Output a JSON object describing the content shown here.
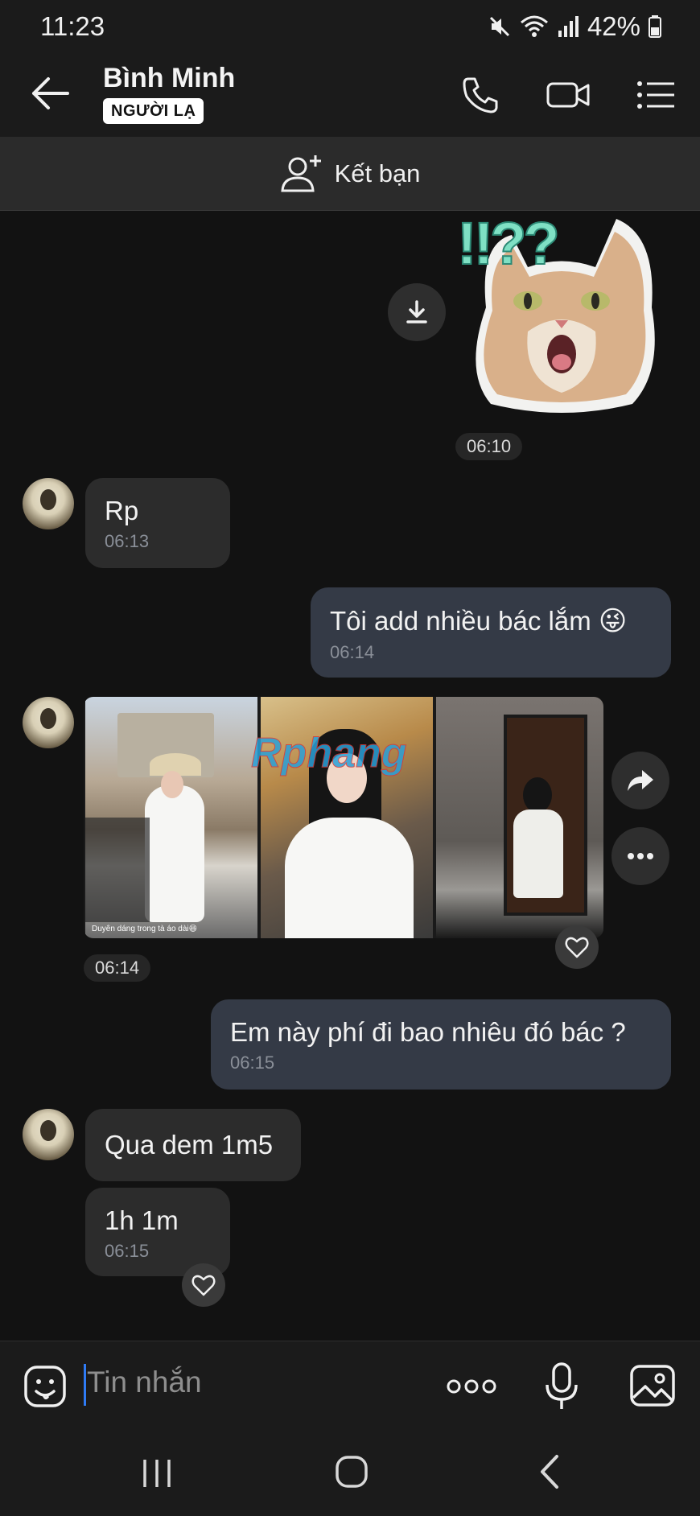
{
  "status_bar": {
    "time": "11:23",
    "battery": "42%"
  },
  "header": {
    "contact_name": "Bình Minh",
    "badge": "NGƯỜI LẠ"
  },
  "add_friend": {
    "label": "Kết bạn"
  },
  "messages": [
    {
      "id": "sticker",
      "direction": "out",
      "type": "sticker",
      "sticker_text": "!!??",
      "time": "06:10"
    },
    {
      "id": "m1",
      "direction": "in",
      "text": "Rp",
      "time": "06:13"
    },
    {
      "id": "m2",
      "direction": "out",
      "text": "Tôi add nhiều bác lắm",
      "emoji": "😜",
      "time": "06:14"
    },
    {
      "id": "m3",
      "direction": "in",
      "type": "photos",
      "count": 3,
      "caption": "Duyên dáng trong tà áo dài😆",
      "watermark": "Rphang",
      "time": "06:14"
    },
    {
      "id": "m4",
      "direction": "out",
      "text": "Em này phí đi bao nhiêu đó bác ?",
      "time": "06:15"
    },
    {
      "id": "m5",
      "direction": "in",
      "text": "Qua dem 1m5"
    },
    {
      "id": "m6",
      "direction": "in",
      "text": "1h 1m",
      "time": "06:15"
    }
  ],
  "composer": {
    "placeholder": "Tin nhắn"
  },
  "icons": [
    "mute-icon",
    "wifi-icon",
    "signal-icon",
    "battery-icon",
    "back-arrow-icon",
    "phone-icon",
    "video-icon",
    "menu-icon",
    "add-friend-icon",
    "download-icon",
    "share-icon",
    "more-icon",
    "heart-icon",
    "sticker-icon",
    "more-dots-icon",
    "mic-icon",
    "image-icon",
    "recents-icon",
    "home-icon",
    "nav-back-icon"
  ],
  "colors": {
    "background": "#121212",
    "incoming_bubble": "#2c2c2c",
    "outgoing_bubble": "#343a46",
    "caret": "#2f7bf5"
  }
}
